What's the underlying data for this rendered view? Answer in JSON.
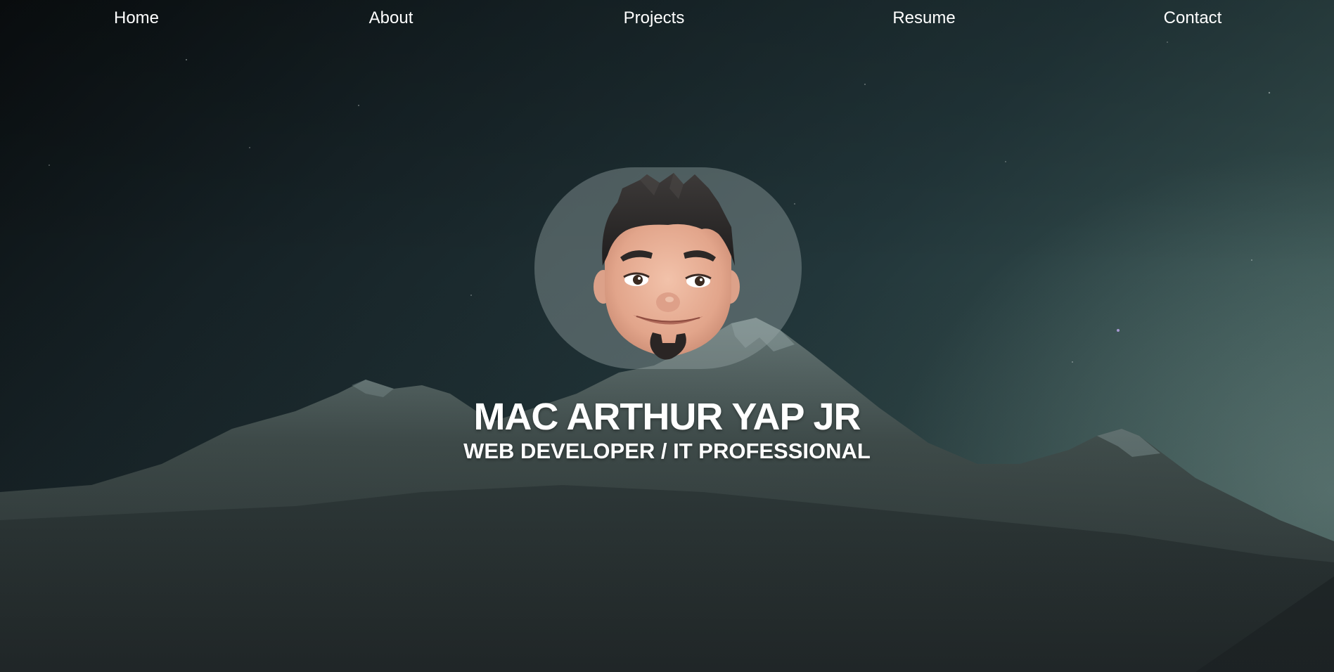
{
  "nav": {
    "items": [
      {
        "label": "Home"
      },
      {
        "label": "About"
      },
      {
        "label": "Projects"
      },
      {
        "label": "Resume"
      },
      {
        "label": "Contact"
      }
    ]
  },
  "hero": {
    "name": "MAC ARTHUR YAP JR",
    "role": "WEB DEVELOPER / IT PROFESSIONAL",
    "avatar_icon": "memoji-avatar-icon",
    "background": "night-sky-mountain-landscape"
  },
  "colors": {
    "text": "#ffffff",
    "sky_dark": "#0a0e10",
    "sky_light": "#4b6663",
    "avatar_bg": "#8c9c9c"
  }
}
